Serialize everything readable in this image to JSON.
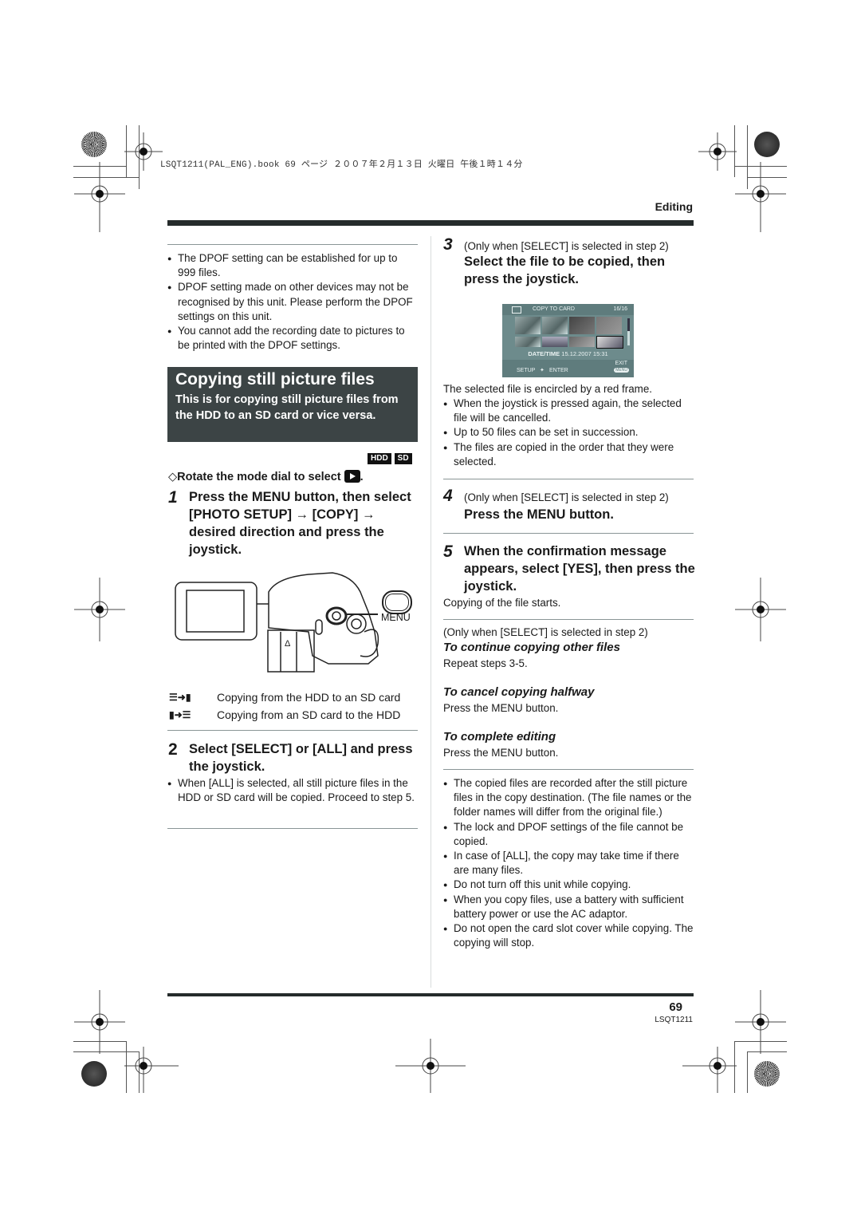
{
  "print_header": "LSQT1211(PAL_ENG).book  69 ページ  ２００７年２月１３日  火曜日  午後１時１４分",
  "section_label": "Editing",
  "left": {
    "notes": [
      "The DPOF setting can be established for up to 999 files.",
      "DPOF setting made on other devices may not be recognised by this unit. Please perform the DPOF settings on this unit.",
      "You cannot add the recording date to pictures to be printed with the DPOF settings."
    ],
    "title": "Copying still picture files",
    "subtitle": "This is for copying still picture files from the HDD to an SD card or vice versa.",
    "badges": [
      "HDD",
      "SD"
    ],
    "dial_instruction": "Rotate the mode dial to select",
    "step1": {
      "num": "1",
      "text": "Press the MENU button, then select [PHOTO SETUP] → [COPY] → desired direction and press the joystick."
    },
    "menu_label": "MENU",
    "directions": [
      {
        "icon": "hdd-to-sd-icon",
        "text": "Copying from the HDD to an SD card"
      },
      {
        "icon": "sd-to-hdd-icon",
        "text": "Copying from an SD card to the HDD"
      }
    ],
    "step2": {
      "num": "2",
      "text": "Select [SELECT] or [ALL] and press the joystick."
    },
    "step2_notes": [
      "When [ALL] is selected, all still picture files in the HDD or SD card will be copied. Proceed to step 5."
    ]
  },
  "right": {
    "step3": {
      "num": "3",
      "pre": "(Only when [SELECT] is selected in step 2)",
      "text": "Select the file to be copied, then press the joystick."
    },
    "lcd": {
      "title": "COPY TO CARD",
      "counter": "16/16",
      "date_label": "DATE/TIME",
      "date_value": "15.12.2007 15:31",
      "setup": "SETUP",
      "enter": "ENTER",
      "exit": "EXIT",
      "menu": "MENU"
    },
    "step3_desc": "The selected file is encircled by a red frame.",
    "step3_notes": [
      "When the joystick is pressed again, the selected file will be cancelled.",
      "Up to 50 files can be set in succession.",
      "The files are copied in the order that they were selected."
    ],
    "step4": {
      "num": "4",
      "pre": "(Only when [SELECT] is selected in step 2)",
      "text": "Press the MENU button."
    },
    "step5": {
      "num": "5",
      "text": "When the confirmation message appears, select [YES], then press the joystick."
    },
    "step5_desc": "Copying of the file starts.",
    "only_select": "(Only when [SELECT] is selected in step 2)",
    "continue_title": "To continue copying other files",
    "continue_text": "Repeat steps 3-5.",
    "cancel_title": "To cancel copying halfway",
    "cancel_text": "Press the MENU button.",
    "complete_title": "To complete editing",
    "complete_text": "Press the MENU button.",
    "final_notes": [
      "The copied files are recorded after the still picture files in the copy destination. (The file names or the folder names will differ from the original file.)",
      "The lock and DPOF settings of the file cannot be copied.",
      "In case of [ALL], the copy may take time if there are many files.",
      "Do not turn off this unit while copying.",
      "When you copy files, use a battery with sufficient battery power or use the AC adaptor.",
      "Do not open the card slot cover while copying. The copying will stop."
    ]
  },
  "footer": {
    "page_number": "69",
    "doc_code": "LSQT1211"
  }
}
